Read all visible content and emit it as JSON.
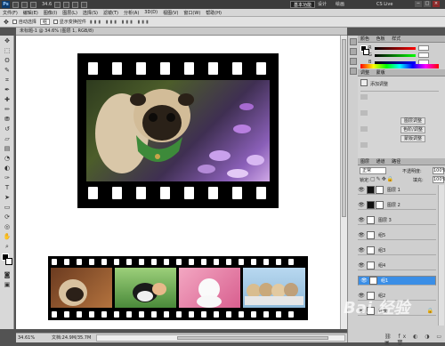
{
  "titlebar": {
    "logo": "Ps",
    "zoom": "34.6",
    "workspace_buttons": [
      "基本功能",
      "设计",
      "绘画"
    ],
    "cslive": "CS Live"
  },
  "menubar": {
    "items": [
      "文件(F)",
      "编辑(E)",
      "图像(I)",
      "图层(L)",
      "选择(S)",
      "滤镜(T)",
      "分析(A)",
      "3D(D)",
      "视图(V)",
      "窗口(W)",
      "帮助(H)"
    ]
  },
  "optbar": {
    "auto_select": "自动选择",
    "auto_select_value": "组",
    "transform": "显示变换控件"
  },
  "document": {
    "tab": "未标题-1 @ 34.6% (图层 1, RGB/8)"
  },
  "status": {
    "zoom": "34.61%",
    "doc": "文档:24.9M/35.7M"
  },
  "panels": {
    "color_tabs": [
      "颜色",
      "色板",
      "样式"
    ],
    "rgb_labels": [
      "R",
      "G",
      "B"
    ],
    "adjust_tabs": [
      "调整",
      "蒙版"
    ],
    "adjust_title": "添加调整",
    "adjust_buttons": [
      "图层调整",
      "色阶/调整",
      "蒙版调整"
    ],
    "layers_tabs": [
      "图层",
      "通道",
      "路径"
    ],
    "blend_mode": "正常",
    "opacity_label": "不透明度:",
    "opacity": "100%",
    "lock_label": "锁定:",
    "fill_label": "填充:",
    "fill": "100%",
    "layers": [
      {
        "name": "图层 1"
      },
      {
        "name": "图层 2"
      },
      {
        "name": "图层 3"
      },
      {
        "name": "组5"
      },
      {
        "name": "组3"
      },
      {
        "name": "组4"
      },
      {
        "name": "组1"
      },
      {
        "name": "组2"
      },
      {
        "name": "背景"
      }
    ],
    "selected_layer": "组1"
  },
  "watermark": "Bai 经验",
  "colors": {
    "accent": "#3a8ee6",
    "bg": "#535353",
    "film": "#000000"
  }
}
